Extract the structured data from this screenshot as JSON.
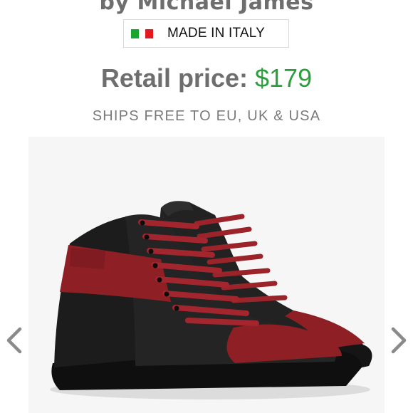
{
  "product": {
    "designer_line": "by Michael James",
    "badge": {
      "flag_icon": "italy-flag-icon",
      "label": "MADE IN ITALY"
    },
    "price": {
      "label": "Retail price:",
      "value": "$179"
    },
    "shipping": "SHIPS FREE TO EU, UK & USA"
  },
  "gallery": {
    "image_alt": "black-and-red-high-top-sneakers",
    "prev_icon": "chevron-left-icon",
    "next_icon": "chevron-right-icon"
  },
  "colors": {
    "price_green": "#2d9e3e",
    "text_gray": "#6e6e6e",
    "shoe_black": "#1b1b1b",
    "shoe_red": "#8d1f25"
  }
}
